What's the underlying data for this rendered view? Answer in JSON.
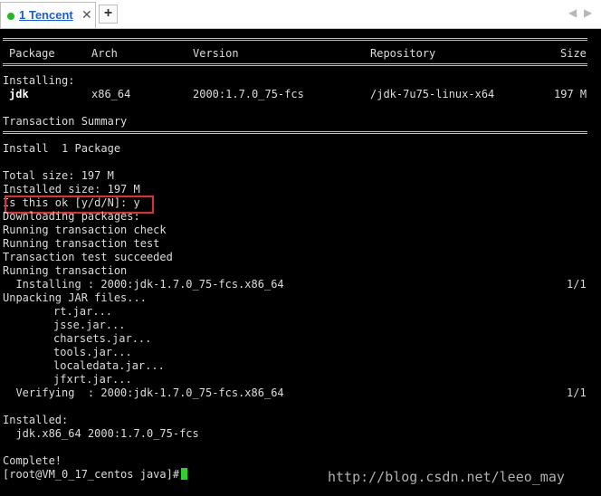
{
  "tabbar": {
    "tab_title": "1 Tencent",
    "close_glyph": "✕",
    "new_tab_glyph": "+",
    "nav_left_glyph": "◀",
    "nav_right_glyph": "▶",
    "status_color": "#1fb81f"
  },
  "terminal": {
    "header": {
      "package": "Package",
      "arch": "Arch",
      "version": "Version",
      "repository": "Repository",
      "size": "Size"
    },
    "installing_label": "Installing:",
    "row": {
      "package": "jdk",
      "arch": "x86_64",
      "version": "2000:1.7.0_75-fcs",
      "repository": "/jdk-7u75-linux-x64",
      "size": "197 M"
    },
    "transaction_summary": "Transaction Summary",
    "install_line": "Install  1 Package",
    "total_size": "Total size: 197 M",
    "installed_size": "Installed size: 197 M",
    "prompt_ok": "Is this ok [y/d/N]: y",
    "lines_block": [
      "Downloading packages:",
      "Running transaction check",
      "Running transaction test",
      "Transaction test succeeded",
      "Running transaction"
    ],
    "installing_step": "  Installing : 2000:jdk-1.7.0_75-fcs.x86_64",
    "installing_count": "1/1",
    "unpacking": "Unpacking JAR files...",
    "jars": [
      "rt.jar...",
      "jsse.jar...",
      "charsets.jar...",
      "tools.jar...",
      "localedata.jar...",
      "jfxrt.jar..."
    ],
    "verifying_step": "  Verifying  : 2000:jdk-1.7.0_75-fcs.x86_64",
    "verifying_count": "1/1",
    "installed_label": "Installed:",
    "installed_item": "  jdk.x86_64 2000:1.7.0_75-fcs",
    "complete": "Complete!",
    "shell_prompt": "[root@VM_0_17_centos java]#",
    "highlight_color": "#e0302e",
    "cursor_color": "#2fd12f"
  },
  "watermark": "http://blog.csdn.net/leeo_may"
}
